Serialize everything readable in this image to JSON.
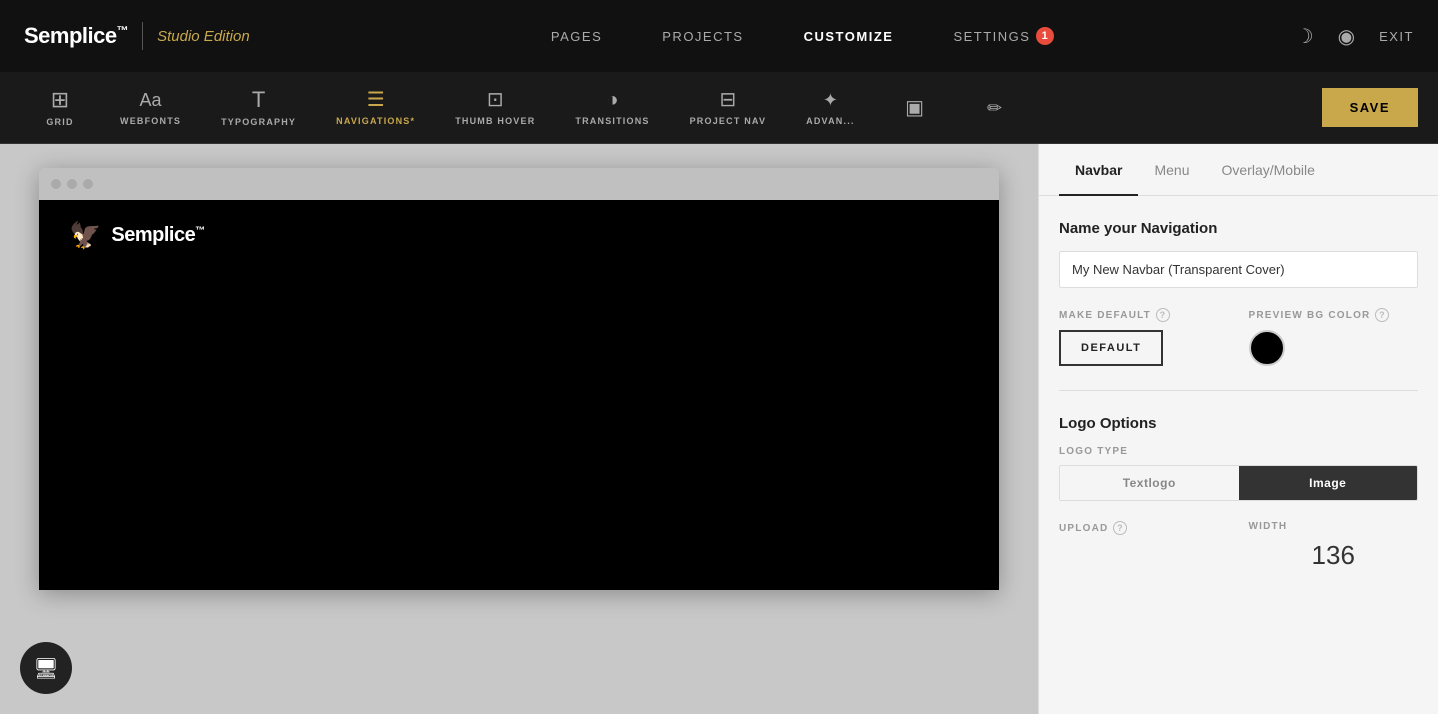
{
  "topNav": {
    "logo": "Semplice",
    "logoTm": "™",
    "edition": "Studio Edition",
    "links": [
      {
        "label": "PAGES",
        "active": false
      },
      {
        "label": "PROJECTS",
        "active": false
      },
      {
        "label": "CUSTOMIZE",
        "active": true
      },
      {
        "label": "SETTINGS",
        "active": false
      }
    ],
    "settingsBadge": "1",
    "exitLabel": "EXIT"
  },
  "toolbar": {
    "items": [
      {
        "id": "grid",
        "label": "GRID",
        "iconClass": "icon-grid",
        "active": false
      },
      {
        "id": "webfonts",
        "label": "WEBFONTS",
        "iconClass": "icon-webfonts",
        "active": false
      },
      {
        "id": "typography",
        "label": "TYPOGRAPHY",
        "iconClass": "icon-typography",
        "active": false
      },
      {
        "id": "navigations",
        "label": "NAVIGATIONS*",
        "iconClass": "icon-nav",
        "active": true
      },
      {
        "id": "thumbhover",
        "label": "THUMB HOVER",
        "iconClass": "icon-thumb",
        "active": false
      },
      {
        "id": "transitions",
        "label": "TRANSITIONS",
        "iconClass": "icon-transitions",
        "active": false
      },
      {
        "id": "projectnav",
        "label": "PROJECT NAV",
        "iconClass": "icon-projectnav",
        "active": false
      },
      {
        "id": "advanced",
        "label": "ADVAN...",
        "iconClass": "icon-advanced",
        "active": false
      },
      {
        "id": "layout",
        "label": "",
        "iconClass": "icon-layout",
        "active": false
      },
      {
        "id": "edit",
        "label": "",
        "iconClass": "icon-edit",
        "active": false
      }
    ],
    "saveLabel": "SAVE"
  },
  "preview": {
    "siteName": "Semplice",
    "siteTm": "™"
  },
  "rightPanel": {
    "tabs": [
      {
        "label": "Navbar",
        "active": true
      },
      {
        "label": "Menu",
        "active": false
      },
      {
        "label": "Overlay/Mobile",
        "active": false
      }
    ],
    "nameSection": {
      "title": "Name your Navigation",
      "inputValue": "My New Navbar (Transparent Cover)"
    },
    "makeDefault": {
      "label": "MAKE DEFAULT",
      "helpTitle": "?",
      "buttonLabel": "DEFAULT"
    },
    "previewBgColor": {
      "label": "PREVIEW BG COLOR",
      "helpTitle": "?",
      "color": "#000000"
    },
    "logoOptions": {
      "title": "Logo Options",
      "logoTypeLabel": "LOGO TYPE",
      "typeButtons": [
        {
          "label": "Textlogo",
          "active": false
        },
        {
          "label": "Image",
          "active": true
        }
      ],
      "uploadLabel": "UPLOAD",
      "uploadHelp": "?",
      "widthLabel": "WIDTH",
      "widthValue": "136"
    }
  }
}
